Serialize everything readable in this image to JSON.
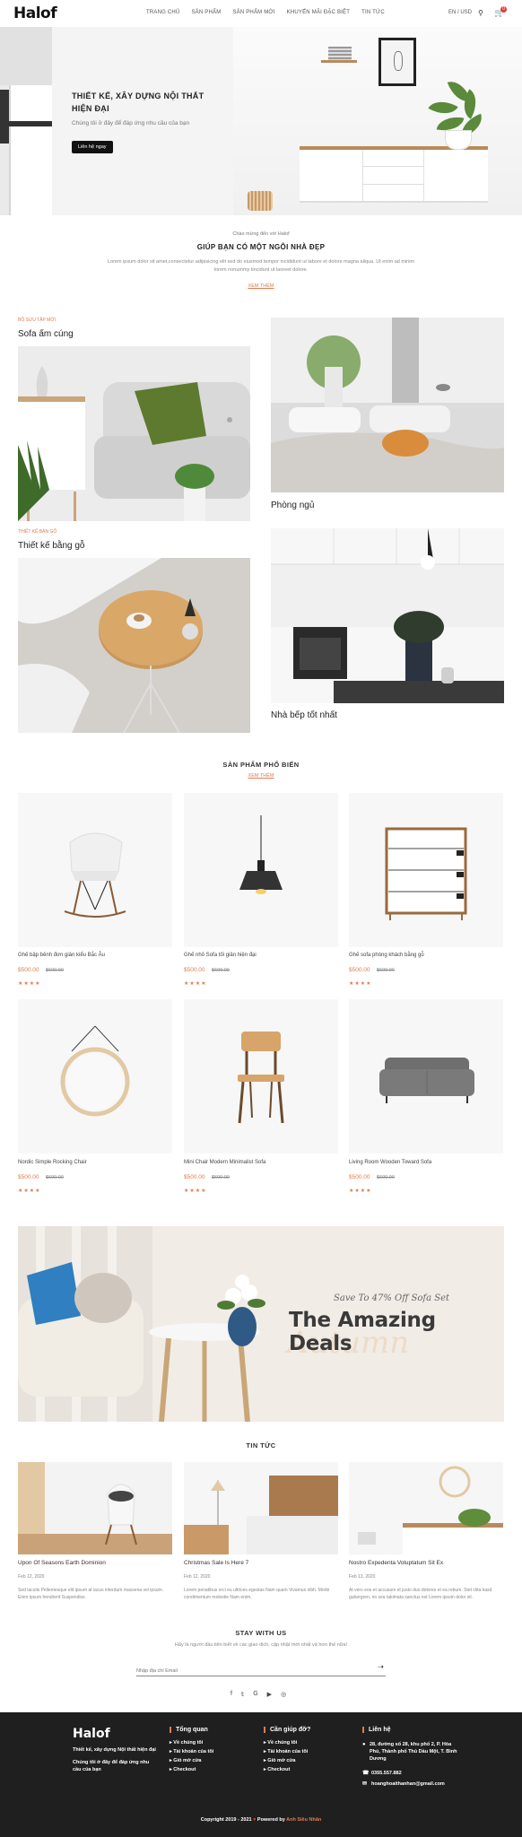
{
  "header": {
    "logo": "Halof",
    "nav": [
      "TRANG CHỦ",
      "SẢN PHẨM",
      "SẢN PHẨM MỚI",
      "KHUYẾN MÃI ĐẶC BIỆT",
      "TIN TỨC"
    ],
    "lang": "EN / USD",
    "cart_count": "0"
  },
  "hero": {
    "title": "THIẾT KẾ, XÂY DỰNG NỘI THẤT HIỆN ĐẠI",
    "subtitle": "Chúng tôi ở đây để đáp ứng nhu cầu của bạn",
    "button": "Liên hệ ngay"
  },
  "welcome": {
    "line1": "Chào mừng đến với Halof",
    "title": "GIÚP BẠN CÓ MỘT NGÔI NHÀ ĐẸP",
    "text": "Lorem ipsum dolor sit amet,consectetur adipisicing elit sed do eiusmod tempor incididunt ut labore et dolore magna aliqua. Ut enim ad minim lorem nonummy tincidunt ut laoreet dolore.",
    "link": "XEM THÊM"
  },
  "categories": {
    "tag1": "BỘ SƯU TẬP MỚI",
    "c1": "Sofa ấm cúng",
    "c2": "Phòng ngủ",
    "tag3": "THIẾT KẾ BÀN GỖ",
    "c3": "Thiết kế bằng gỗ",
    "c4": "Nhà bếp tốt nhất"
  },
  "popular": {
    "title": "SẢN PHẨM PHỔ BIẾN",
    "link": "XEM THÊM",
    "products": [
      {
        "name": "Ghế bập bênh đơn giản kiểu Bắc Âu",
        "price": "$500.00",
        "old": "$600.00",
        "stars": "★★★★"
      },
      {
        "name": "Ghế nhỏ Sofa tối giản hiện đại",
        "price": "$500.00",
        "old": "$600.00",
        "stars": "★★★★"
      },
      {
        "name": "Ghế sofa phòng khách bằng gỗ",
        "price": "$500.00",
        "old": "$600.00",
        "stars": "★★★★"
      },
      {
        "name": "Nordic Simple Rocking Chair",
        "price": "$500.00",
        "old": "$600.00",
        "stars": "★★★★"
      },
      {
        "name": "Mini Chair Modern Minimalist Sofa",
        "price": "$500.00",
        "old": "$600.00",
        "stars": "★★★★"
      },
      {
        "name": "Living Room Wooden Toward Sofa",
        "price": "$500.00",
        "old": "$600.00",
        "stars": "★★★★"
      }
    ]
  },
  "deals": {
    "sub": "Save To 47% Off Sofa Set",
    "title": "The Amazing Deals"
  },
  "news": {
    "title": "TIN TỨC",
    "items": [
      {
        "title": "Upon Of Seasons Earth Dominion",
        "date": "Feb 12, 2020",
        "text": "Sed iaculis Pellentesque elit ipsum at iacus interdum massena vel ipsum. Enim ipsum hendrerit Suspendiss."
      },
      {
        "title": "Christmas Sale Is Here 7",
        "date": "Feb 12, 2020",
        "text": "Lorem penatibus orci eu ultrices egestas Nam quam Vivamus nibh. Morbi condimentum molestie Nam enim."
      },
      {
        "title": "Nostro Expedenta Voluptatum Sit Ex",
        "date": "Feb 13, 2020",
        "text": "At vero eos et accusam et justo duo dolores et ea rebum. Stet clita kasd gubergren, no sea takimata sanctus est Lorem ipsum dolor sit."
      }
    ]
  },
  "stay": {
    "title": "STAY WITH US",
    "text": "Hãy là người đầu tiên biết về các giao dịch, cập nhật mới nhất và hơn thế nữa!",
    "placeholder": "Nhập địa chỉ Email"
  },
  "social": [
    "f",
    "𝕥",
    "G",
    "▶",
    "◎"
  ],
  "footer": {
    "logo": "Halof",
    "tagline": "Thiết kế, xây dựng Nội thất hiện đại",
    "desc": "Chúng tôi ở đây để đáp ứng nhu cầu của bạn",
    "col1": {
      "title": "Tổng quan",
      "items": [
        "Về chúng tôi",
        "Tài khoản của tôi",
        "Giỏ mở cửa",
        "Checkout"
      ]
    },
    "col2": {
      "title": "Cần giúp đỡ?",
      "items": [
        "Về chúng tôi",
        "Tài khoản của tôi",
        "Giỏ mở cửa",
        "Checkout"
      ]
    },
    "col3": {
      "title": "Liên hệ",
      "address": "28, đường số 28, khu phố 2, P. Hòa Phú, Thành phố Thủ Dầu Một, T. Bình Dương",
      "phone": "0355.557.882",
      "email": "hoanghoaithanhan@gmail.com"
    },
    "copy_pre": "Copyright 2019 - 2021",
    "copy_heart": "♥",
    "copy_mid": "Powered by",
    "copy_author": "Anh Siêu Nhân"
  }
}
